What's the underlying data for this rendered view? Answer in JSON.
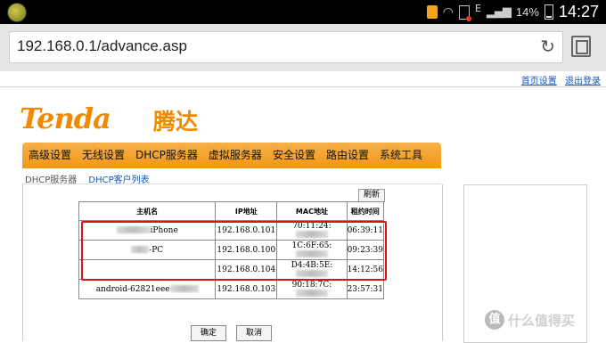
{
  "status_bar": {
    "battery": "14%",
    "time": "14:27",
    "network_letter": "E",
    "icons": [
      "app-icon",
      "document-icon",
      "wifi-icon",
      "no-sim-icon",
      "signal-icon",
      "battery-icon"
    ]
  },
  "browser": {
    "url": "192.168.0.1/advance.asp",
    "icons": [
      "reload-icon",
      "tabs-icon"
    ]
  },
  "header": {
    "links": [
      "首页设置",
      "退出登录"
    ],
    "logo_text": "Tenda",
    "logo_cn": "腾达"
  },
  "nav": [
    "高级设置",
    "无线设置",
    "DHCP服务器",
    "虚拟服务器",
    "安全设置",
    "路由设置",
    "系统工具"
  ],
  "subnav": [
    "DHCP服务器",
    "DHCP客户列表"
  ],
  "refresh_label": "刷新",
  "table": {
    "headers": [
      "主机名",
      "IP地址",
      "MAC地址",
      "租约时间"
    ],
    "rows": [
      {
        "host": "iPhone",
        "ip": "192.168.0.101",
        "mac": "70:11:24:",
        "lease": "06:39:11"
      },
      {
        "host": "-PC",
        "ip": "192.168.0.100",
        "mac": "1C:6F:65:",
        "lease": "09:23:39"
      },
      {
        "host": "",
        "ip": "192.168.0.104",
        "mac": "D4:4B:5E:",
        "lease": "14:12:56"
      },
      {
        "host": "android-62821eee",
        "ip": "192.168.0.103",
        "mac": "90:18:7C:",
        "lease": "23:57:31"
      }
    ]
  },
  "buttons": {
    "ok": "确定",
    "cancel": "取消"
  },
  "watermark": {
    "icon": "值",
    "text": "什么值得买"
  },
  "colors": {
    "brand_orange": "#f18a00",
    "nav_orange": "#f09a1c",
    "highlight_red": "#e0101a",
    "link_blue": "#1a57b8"
  }
}
